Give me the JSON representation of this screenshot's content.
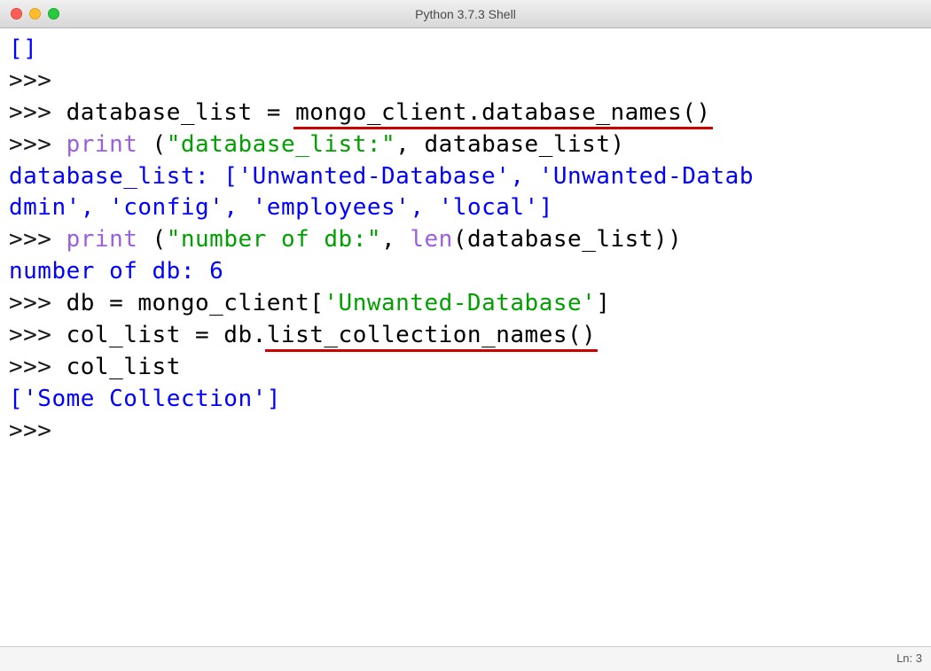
{
  "window": {
    "title": "Python 3.7.3 Shell"
  },
  "lines": {
    "l0": "[]",
    "l1_prompt": ">>>",
    "l2_prompt": ">>> ",
    "l2_code_a": "database_list = ",
    "l2_code_b": "mongo_client.database_names()",
    "l3_prompt": ">>> ",
    "l3_print": "print",
    "l3_paren1": " (",
    "l3_str": "\"database_list:\"",
    "l3_rest": ", database_list)",
    "l4_out_a": "database_list: [",
    "l4_out_b": "'Unwanted-Database'",
    "l4_out_c": ", ",
    "l4_out_d": "'Unwanted-Datab",
    "l5_out_a": "dmin'",
    "l5_out_b": ", ",
    "l5_out_c": "'config'",
    "l5_out_d": ", ",
    "l5_out_e": "'employees'",
    "l5_out_f": ", ",
    "l5_out_g": "'local'",
    "l5_out_h": "]",
    "l6_prompt": ">>> ",
    "l6_print": "print",
    "l6_paren1": " (",
    "l6_str": "\"number of db:\"",
    "l6_rest1": ", ",
    "l6_len": "len",
    "l6_rest2": "(database_list))",
    "l7_out": "number of db: 6",
    "l8_prompt": ">>> ",
    "l8_code_a": "db = mongo_client[",
    "l8_str": "'Unwanted-Database'",
    "l8_code_b": "]",
    "l9_prompt": ">>> ",
    "l9_code_a": "col_list = db.",
    "l9_code_b": "list_collection_names()",
    "l10_prompt": ">>> ",
    "l10_code": "col_list",
    "l11_a": "[",
    "l11_b": "'Some Collection'",
    "l11_c": "]",
    "l12_prompt": ">>> "
  },
  "statusbar": {
    "text": "Ln: 3"
  }
}
